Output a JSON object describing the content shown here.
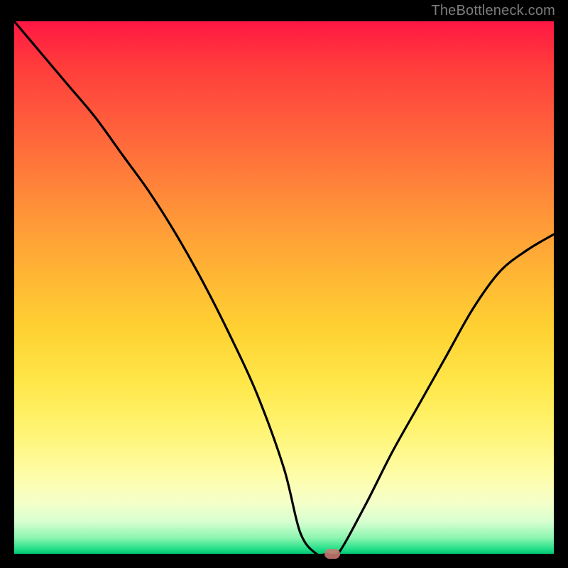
{
  "watermark": "TheBottleneck.com",
  "chart_data": {
    "type": "line",
    "title": "",
    "xlabel": "",
    "ylabel": "",
    "xlim": [
      0,
      100
    ],
    "ylim": [
      0,
      100
    ],
    "x": [
      0,
      5,
      10,
      15,
      20,
      25,
      30,
      35,
      40,
      45,
      50,
      53,
      56,
      58,
      60,
      65,
      70,
      75,
      80,
      85,
      90,
      95,
      100
    ],
    "y": [
      100,
      94,
      88,
      82,
      75,
      68,
      60,
      51,
      41,
      30,
      16,
      4,
      0,
      0,
      0,
      9,
      19,
      28,
      37,
      46,
      53,
      57,
      60
    ],
    "marker": {
      "x": 59,
      "y": 0
    },
    "background_gradient": {
      "top": "#ff1744",
      "mid": "#ffd232",
      "bottom": "#00c775"
    },
    "curve_color": "#000000",
    "marker_color": "#c97a72"
  }
}
